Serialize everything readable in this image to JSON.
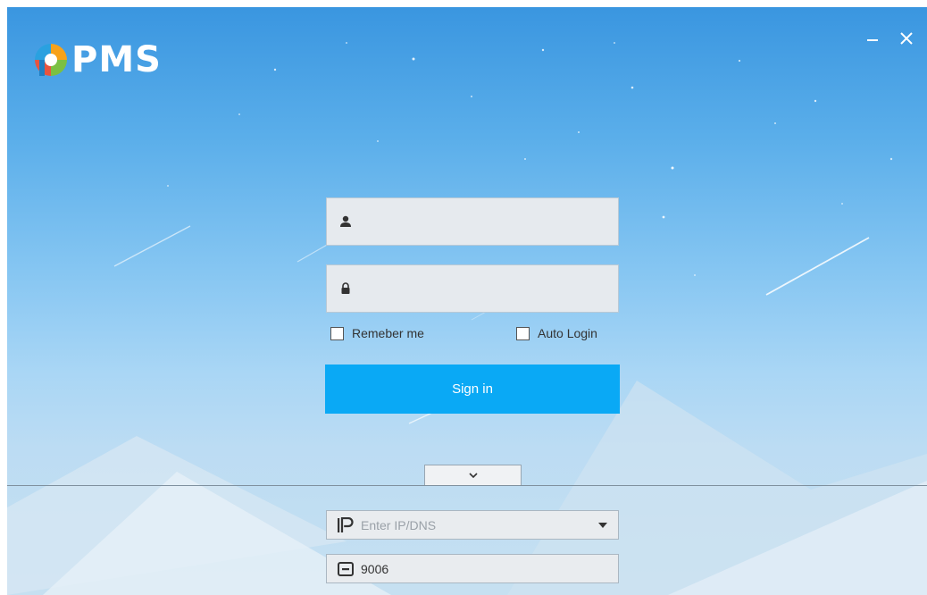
{
  "app": {
    "logo_text": "PMS",
    "colors": {
      "sky_top": "#3a96e0",
      "sky_bottom": "#c6e0f1",
      "signin_button": "#0aa9f5",
      "field_bg": "#e6eaee"
    }
  },
  "window_controls": {
    "minimize_icon": "minimize-icon",
    "close_icon": "close-icon"
  },
  "login": {
    "username": {
      "icon": "user-icon",
      "value": ""
    },
    "password": {
      "icon": "lock-icon",
      "value": ""
    },
    "remember_label": "Remeber me",
    "remember_checked": false,
    "auto_login_label": "Auto Login",
    "auto_login_checked": false,
    "signin_label": "Sign in"
  },
  "server": {
    "toggle_icon": "chevron-down-icon",
    "ip": {
      "icon": "ip-icon",
      "placeholder": "Enter IP/DNS",
      "value": ""
    },
    "port": {
      "icon": "port-icon",
      "value": "9006"
    }
  }
}
